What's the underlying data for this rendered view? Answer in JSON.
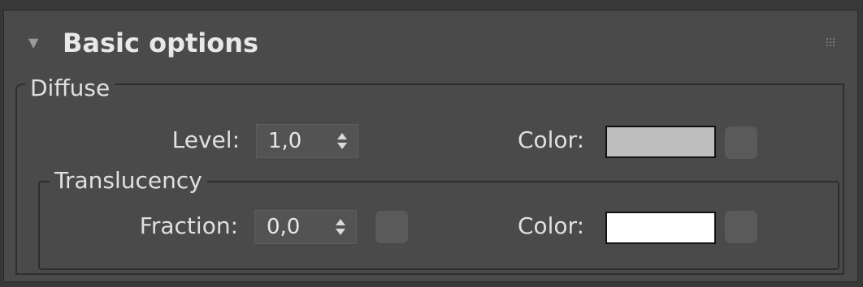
{
  "panel": {
    "title": "Basic options",
    "collapse_icon": "triangle-down-icon",
    "grip_icon": "drag-grip-icon"
  },
  "diffuse": {
    "legend": "Diffuse",
    "level_label": "Level:",
    "level_value": "1,0",
    "color_label": "Color:",
    "color_swatch": "#bdbdbd"
  },
  "translucency": {
    "legend": "Translucency",
    "fraction_label": "Fraction:",
    "fraction_value": "0,0",
    "color_label": "Color:",
    "color_swatch": "#ffffff"
  }
}
